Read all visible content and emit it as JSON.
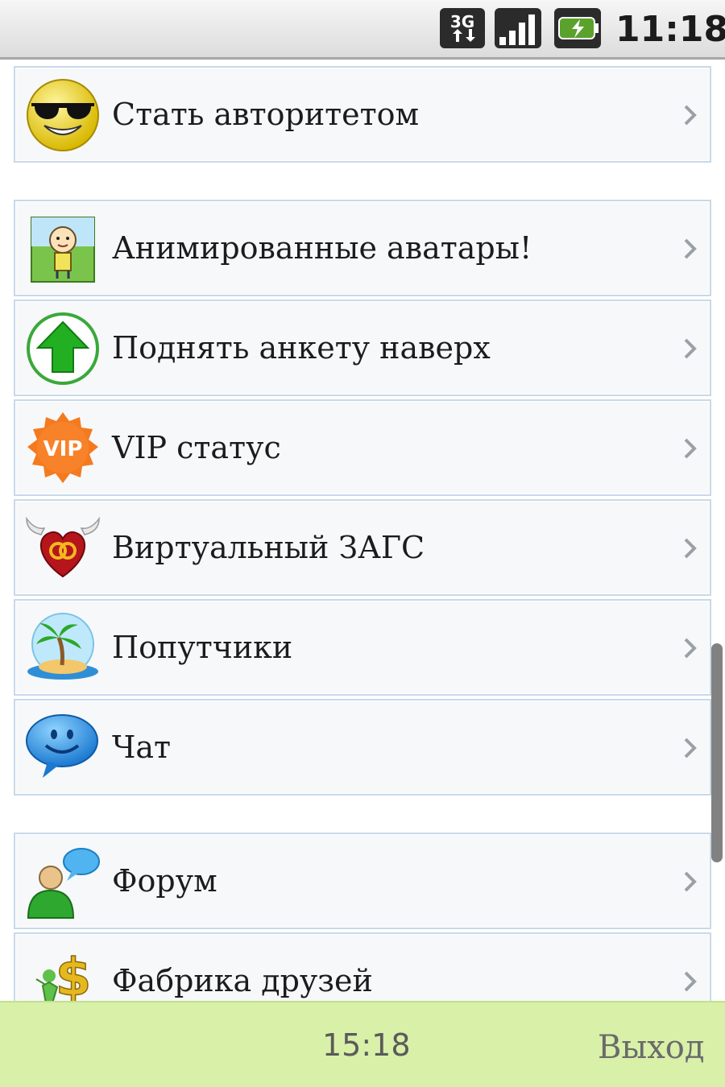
{
  "status_bar": {
    "network_type": "3G",
    "time": "11:18",
    "icons": [
      "3g-data-icon",
      "signal-strength-icon",
      "battery-charging-icon"
    ]
  },
  "menu": {
    "items": [
      {
        "label": "Стать авторитетом",
        "icon": "sunglasses-smiley-icon"
      },
      {
        "label": "Анимированные аватары!",
        "icon": "animated-avatar-icon"
      },
      {
        "label": "Поднять анкету наверх",
        "icon": "green-up-arrow-icon"
      },
      {
        "label": "VIP статус",
        "icon": "vip-badge-icon",
        "badge_text": "VIP"
      },
      {
        "label": "Виртуальный ЗАГС",
        "icon": "winged-heart-rings-icon"
      },
      {
        "label": "Попутчики",
        "icon": "palm-island-icon"
      },
      {
        "label": "Чат",
        "icon": "chat-bubble-smiley-icon"
      },
      {
        "label": "Форум",
        "icon": "forum-user-bubble-icon"
      },
      {
        "label": "Фабрика друзей",
        "icon": "dollar-figure-icon"
      }
    ]
  },
  "bottom_bar": {
    "time": "15:18",
    "exit_label": "Выход"
  },
  "colors": {
    "status_bar_bg": "#e6e6e6",
    "item_border": "#c8d9ea",
    "item_bg": "#f7f8fa",
    "bottom_bar_bg": "#d8f0a8",
    "chevron": "#9aa0a6"
  }
}
